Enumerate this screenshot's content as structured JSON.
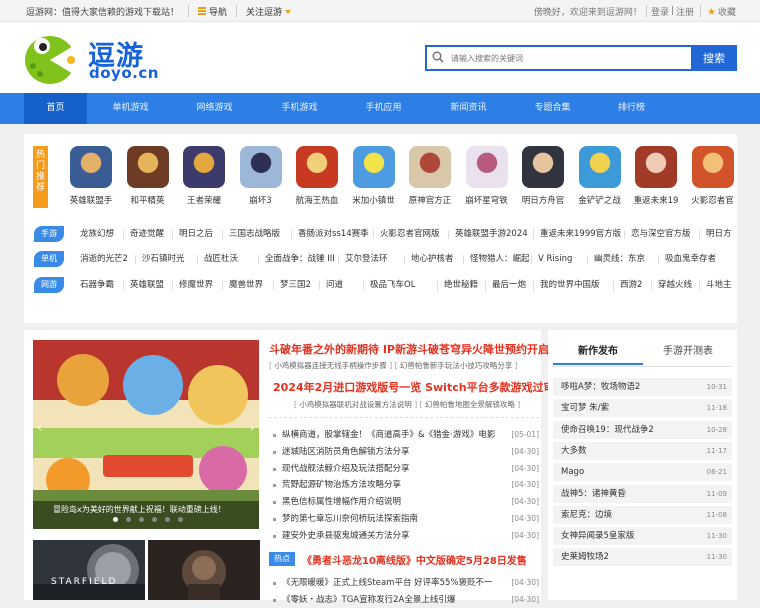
{
  "topbar": {
    "slogan": "逗游网：值得大家信赖的游戏下载站！",
    "nav_label": "导航",
    "follow_label": "关注逗游",
    "greeting": "傍晚好，欢迎来到逗游网！",
    "login": "登录",
    "register": "注册",
    "favorite": "收藏"
  },
  "logo": {
    "cn": "逗游",
    "domain": "doyo.cn"
  },
  "search": {
    "placeholder": "请输入搜索的关键词",
    "button": "搜索"
  },
  "nav": [
    "首页",
    "单机游戏",
    "网络游戏",
    "手机游戏",
    "手机应用",
    "新闻资讯",
    "专题合集",
    "排行榜"
  ],
  "hot": {
    "badge": "热门推荐",
    "games": [
      {
        "name": "英雄联盟手",
        "color": "#3b5d95",
        "accent": "#e3b06a"
      },
      {
        "name": "和平精英",
        "color": "#6e3b24",
        "accent": "#e5b35a"
      },
      {
        "name": "王者荣耀",
        "color": "#3d3b6c",
        "accent": "#e3a83f"
      },
      {
        "name": "崩坏3",
        "color": "#9cb7d8",
        "accent": "#2e2f55"
      },
      {
        "name": "航海王热血",
        "color": "#c73a21",
        "accent": "#f1cf7a"
      },
      {
        "name": "米加小镇世",
        "color": "#4d9be0",
        "accent": "#f2e34a"
      },
      {
        "name": "原神官方正",
        "color": "#d8c7a8",
        "accent": "#ae4838"
      },
      {
        "name": "崩坏星穹铁",
        "color": "#e9e2ee",
        "accent": "#b65b7d"
      },
      {
        "name": "明日方舟官",
        "color": "#31343f",
        "accent": "#e6c4a0"
      },
      {
        "name": "金铲铲之战",
        "color": "#3d9ad9",
        "accent": "#f0d14e"
      },
      {
        "name": "重返未来19",
        "color": "#a23a28",
        "accent": "#efcbb6"
      },
      {
        "name": "火影忍者官",
        "color": "#d2522a",
        "accent": "#f3c078"
      }
    ]
  },
  "rows": [
    {
      "tag": "手游",
      "links": [
        "龙族幻想",
        "奇迹觉醒",
        "明日之后",
        "三国志战略版",
        "香肠派对ss14赛季",
        "火影忍者官网版",
        "英雄联盟手游2024",
        "重返未来1999官方版",
        "恋与深空官方版",
        "明日方"
      ]
    },
    {
      "tag": "单机",
      "links": [
        "消逝的光芒2",
        "沙石镇时光",
        "战匠杜沃",
        "全面战争：战锤 III",
        "艾尔登法环",
        "地心护核者",
        "怪物猎人：崛起",
        "V Rising",
        "幽灵线：东京",
        "吸血鬼幸存者"
      ]
    },
    {
      "tag": "网游",
      "links": [
        "石器争霸",
        "英雄联盟",
        "修魔世界",
        "魔兽世界",
        "梦三国2",
        "问道",
        "极品飞车OL",
        "绝世秘籍",
        "最后一炮",
        "我的世界中国版",
        "西游2",
        "穿越火线",
        "斗地主"
      ]
    }
  ],
  "banner": {
    "caption": "冒险岛x为美好的世界献上祝福！联动重磅上线！"
  },
  "headline": {
    "title": "斗破年番之外的新期待 IP新游斗破苍穹异火降世预约开启",
    "sub1": "小鸡模拟器连接无线手柄操作步骤",
    "sub1b": "幻兽帕鲁新手玩法小技巧攻略分享",
    "title2": "2024年2月进口游戏版号一览 Switch平台多款游戏过审",
    "sub2": "小鸡模拟器联机对战设置方法说明",
    "sub2b": "幻兽帕鲁地图全景解锁攻略"
  },
  "news": [
    {
      "title": "纵横商道，股掌辖金！《商道高手》&《猎金·游戏》电影",
      "date": "[05-01]"
    },
    {
      "title": "迷城陆区消防员角色解锁方法分享",
      "date": "[04-30]"
    },
    {
      "title": "现代战舰法鲸介绍及玩法搭配分享",
      "date": "[04-30]"
    },
    {
      "title": "荒野起源矿物治炼方法攻略分享",
      "date": "[04-30]"
    },
    {
      "title": "黑色信标属性增幅作用介绍说明",
      "date": "[04-30]"
    },
    {
      "title": "梦的第七章忘川奈何桥玩法探索指南",
      "date": "[04-30]"
    },
    {
      "title": "建安外史承县驱鬼城通关方法分享",
      "date": "[04-30]"
    }
  ],
  "hotnews": {
    "label": "热点",
    "title": "《勇者斗恶龙10离线版》中文版确定5月28日发售",
    "items": [
      {
        "title": "《无限暖暖》正式上线Steam平台 好评率55%褒贬不一",
        "date": "[04-30]"
      },
      {
        "title": "《零妖・战志》TGA宣称发行2A全景上线引爆",
        "date": "[04-30]"
      }
    ],
    "thumb_text": "STARFIELD"
  },
  "side": {
    "tabs": [
      "新作发布",
      "手游开测表"
    ],
    "items": [
      {
        "title": "哆啦A梦：牧场物语2",
        "date": "10-31"
      },
      {
        "title": "宝可梦 朱/紫",
        "date": "11-18"
      },
      {
        "title": "使命召唤19：现代战争2",
        "date": "10-28"
      },
      {
        "title": "大多数",
        "date": "11-17"
      },
      {
        "title": "Mago",
        "date": "06-21"
      },
      {
        "title": "战神5：诸神黄昏",
        "date": "11-09"
      },
      {
        "title": "索尼克：边境",
        "date": "11-08"
      },
      {
        "title": "女神异闻录5皇家版",
        "date": "11-30"
      },
      {
        "title": "史莱姆牧场2",
        "date": "11-30"
      }
    ]
  }
}
